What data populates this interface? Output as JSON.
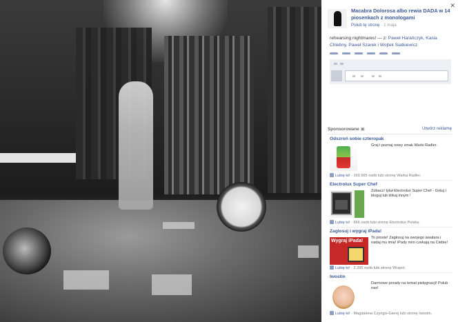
{
  "viewer": {
    "photo_alt": "Black and white photo of a rehearsal on stage",
    "close_icon": "close-icon"
  },
  "page": {
    "name": "Macabra Dolorosa albo rewia DADA w 14 piosenkach z monologami",
    "like_link": "Polub tę stronę",
    "separator": " · ",
    "date": "1 maja"
  },
  "caption": {
    "text": "rehearsing nightmares! — z: ",
    "tags": "Paweł Harańczyk, Kasia Chlebny, Paweł Szarek i Wojtek Siatkiewicz"
  },
  "sponsored": {
    "label": "Sponsorowane",
    "count_icon": "ads-count-icon",
    "create_link": "Utwórz reklamę"
  },
  "ads": [
    {
      "title": "Odszroń sobie czteropak",
      "text": "Graj i poznaj nowy smak Warki Radler.",
      "like": "Lubię to!",
      "social": " · 169.565 osób lubi stronę Warka Radler."
    },
    {
      "title": "Electrolux Super Chef",
      "text": "Zobacz! tytuł Electrolux Super Chef - Gotuj i bloguj lub klikaj innym !",
      "like": "Lubię to!",
      "social": " · 666 osób lubi stronę Electrolux Polska."
    },
    {
      "title": "Zaglosuj i wygraj iPada!",
      "image_text": "Wygraj iPada!",
      "text": "To proste! Zagłosuj na swojego awatara i nadaj mu imię! iPady mini czekają na Ciebie!",
      "like": "Lubię to!",
      "social": " · 2.395 osób lubi stronę Wrapol."
    },
    {
      "title": "Iwostin",
      "text": "Darmowe porady na temat pielęgnacji! Polub nas!",
      "like": "Lubię to!",
      "social": " · Magdalena Czyngis-Gierej lubi stronę Iwostin."
    }
  ],
  "colors": {
    "link": "#3b5998",
    "comment_bg": "#edeff4",
    "photo_bg": "#242424"
  }
}
